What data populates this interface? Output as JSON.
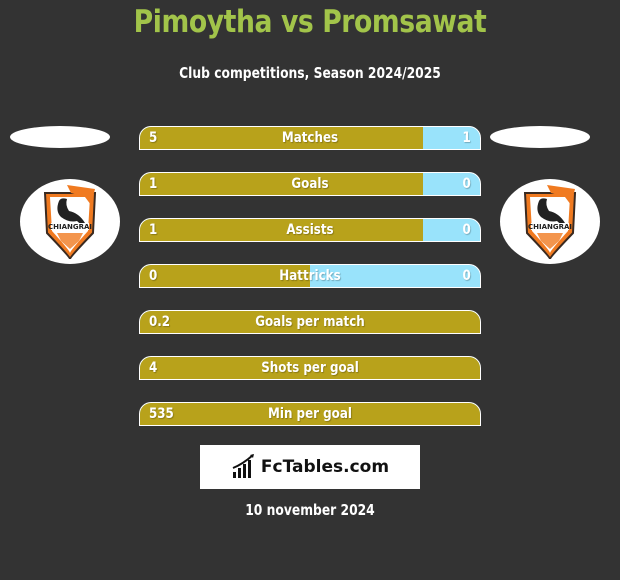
{
  "header": {
    "title": "Pimoytha vs Promsawat",
    "subtitle": "Club competitions, Season 2024/2025"
  },
  "teams": {
    "left": {
      "name": "Pimoytha",
      "crest": "chiangrai-united-crest"
    },
    "right": {
      "name": "Promsawat",
      "crest": "chiangrai-united-crest"
    }
  },
  "colors": {
    "background": "#333333",
    "title": "#a2c44a",
    "left_bar": "#b8a21b",
    "right_bar": "#99e3fb"
  },
  "stats": [
    {
      "label": "Matches",
      "left": "5",
      "right": "1",
      "left_share": 0.833
    },
    {
      "label": "Goals",
      "left": "1",
      "right": "0",
      "left_share": 0.833
    },
    {
      "label": "Assists",
      "left": "1",
      "right": "0",
      "left_share": 0.833
    },
    {
      "label": "Hattricks",
      "left": "0",
      "right": "0",
      "left_share": 0.5
    },
    {
      "label": "Goals per match",
      "left": "0.2",
      "right": "",
      "left_share": 1.0
    },
    {
      "label": "Shots per goal",
      "left": "4",
      "right": "",
      "left_share": 1.0
    },
    {
      "label": "Min per goal",
      "left": "535",
      "right": "",
      "left_share": 1.0
    }
  ],
  "branding": {
    "logo_text": "FcTables.com",
    "logo_icon": "bar-chart-icon"
  },
  "footer": {
    "date": "10 november 2024"
  }
}
